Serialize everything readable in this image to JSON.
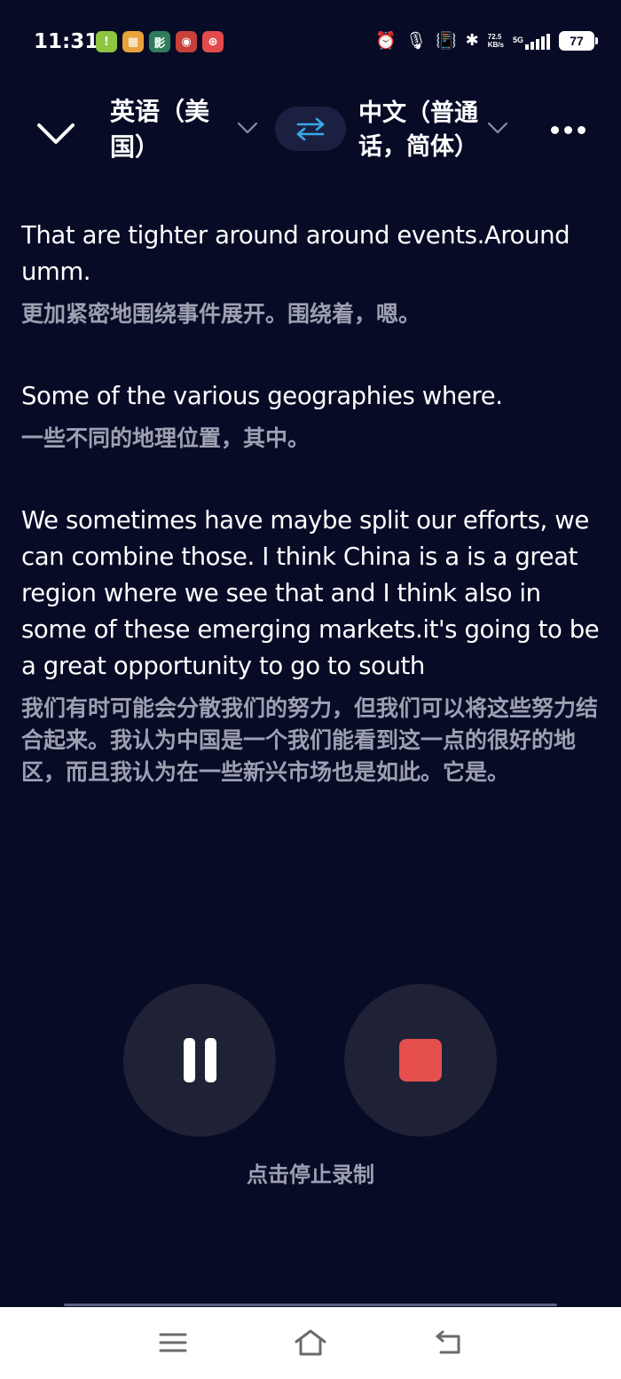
{
  "status_bar": {
    "time": "11:31",
    "app_icons": [
      {
        "name": "app-icon-1",
        "glyph": "!",
        "color": "#8dc63f"
      },
      {
        "name": "app-icon-2",
        "glyph": "▦",
        "color": "#e9a23b"
      },
      {
        "name": "app-icon-3",
        "glyph": "影",
        "color": "#2e7d5a"
      },
      {
        "name": "app-icon-4",
        "glyph": "◉",
        "color": "#c8403a"
      },
      {
        "name": "app-icon-5",
        "glyph": "⊕",
        "color": "#e34a4a"
      }
    ],
    "net_speed_value": "72.5",
    "net_speed_unit": "KB/s",
    "network_type": "5G",
    "battery": "77"
  },
  "toolbar": {
    "source_language": "英语（美国）",
    "target_language": "中文（普通话，简体）",
    "collapse_icon": "chevron-down-icon",
    "swap_icon": "swap-arrows-icon",
    "more_icon": "more-dots-icon",
    "accent_color": "#39a8e8"
  },
  "transcript": [
    {
      "en": "That are tighter around around events.Around umm.",
      "zh": "更加紧密地围绕事件展开。围绕着，嗯。"
    },
    {
      "en": "Some of the various geographies where.",
      "zh": "一些不同的地理位置，其中。"
    },
    {
      "en": "We sometimes have maybe split our efforts, we can combine those. I think China is a is a great region where we see that and I think also in some of these emerging markets.it's going to be a great opportunity to go to south",
      "zh": "我们有时可能会分散我们的努力，但我们可以将这些努力结合起来。我认为中国是一个我们能看到这一点的很好的地区，而且我认为在一些新兴市场也是如此。它是。"
    }
  ],
  "controls": {
    "pause_icon": "pause-icon",
    "stop_icon": "stop-icon",
    "stop_color": "#e5504f",
    "hint": "点击停止录制"
  },
  "nav_bar": {
    "menu_icon": "menu-icon",
    "home_icon": "home-icon",
    "back_icon": "back-icon"
  }
}
